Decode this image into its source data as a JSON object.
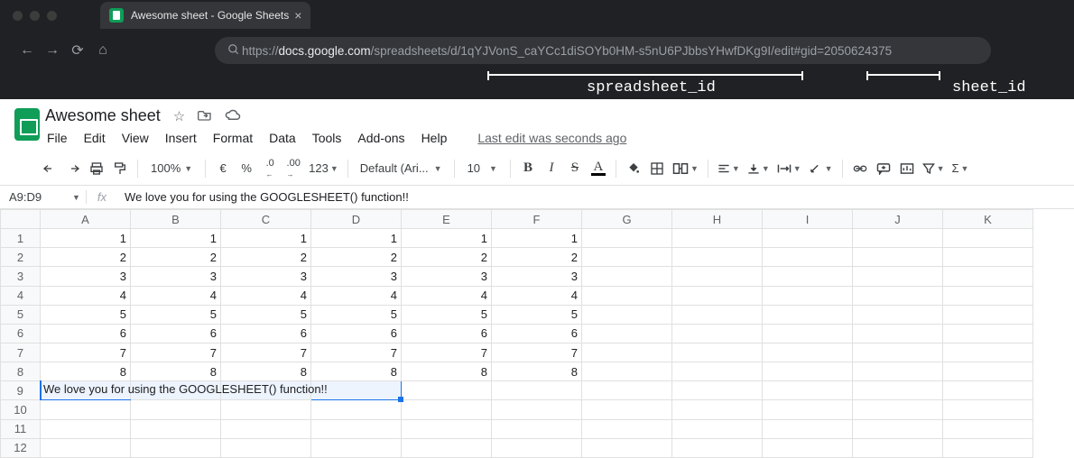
{
  "browser": {
    "tab_title": "Awesome sheet - Google Sheets",
    "url_prefix": "https://",
    "url_host": "docs.google.com",
    "url_path": "/spreadsheets/d/1qYJVonS_caYCc1diSOYb0HM-s5nU6PJbbsYHwfDKg9I/edit#gid=2050624375"
  },
  "annotations": {
    "spreadsheet_id": "spreadsheet_id",
    "sheet_id": "sheet_id"
  },
  "doc": {
    "title": "Awesome sheet",
    "menus": [
      "File",
      "Edit",
      "View",
      "Insert",
      "Format",
      "Data",
      "Tools",
      "Add-ons",
      "Help"
    ],
    "last_edit": "Last edit was seconds ago"
  },
  "toolbar": {
    "zoom": "100%",
    "currency": "€",
    "percent": "%",
    "dec_dec": ".0",
    "inc_dec": ".00",
    "more_formats": "123",
    "font": "Default (Ari...",
    "font_size": "10",
    "bold": "B",
    "italic": "I",
    "strike": "S",
    "text_color": "A",
    "sigma": "Σ"
  },
  "formula": {
    "name_box": "A9:D9",
    "fx": "fx",
    "value": "We love you for using the GOOGLESHEET() function!!"
  },
  "grid": {
    "columns": [
      "A",
      "B",
      "C",
      "D",
      "E",
      "F",
      "G",
      "H",
      "I",
      "J",
      "K"
    ],
    "num_rows": 12,
    "data_rows": [
      [
        1,
        1,
        1,
        1,
        1,
        1
      ],
      [
        2,
        2,
        2,
        2,
        2,
        2
      ],
      [
        3,
        3,
        3,
        3,
        3,
        3
      ],
      [
        4,
        4,
        4,
        4,
        4,
        4
      ],
      [
        5,
        5,
        5,
        5,
        5,
        5
      ],
      [
        6,
        6,
        6,
        6,
        6,
        6
      ],
      [
        7,
        7,
        7,
        7,
        7,
        7
      ],
      [
        8,
        8,
        8,
        8,
        8,
        8
      ]
    ],
    "row9_text": "We love you for using the GOOGLESHEET() function!!"
  }
}
